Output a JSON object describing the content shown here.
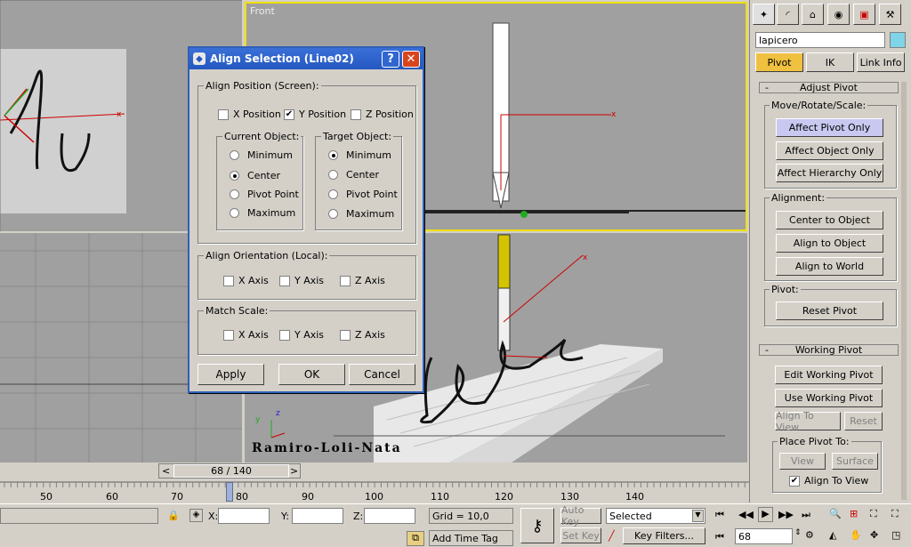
{
  "viewports": {
    "front_label": "Front",
    "watermark": "Ramiro-Loli-Nata"
  },
  "dialog": {
    "title": "Align Selection (Line02)",
    "help_btn": "?",
    "close_btn": "✕",
    "align_position_group": "Align Position (Screen):",
    "x_position": "X Position",
    "y_position": "Y Position",
    "z_position": "Z Position",
    "current_object_group": "Current Object:",
    "target_object_group": "Target Object:",
    "opt_minimum": "Minimum",
    "opt_center": "Center",
    "opt_pivot": "Pivot Point",
    "opt_maximum": "Maximum",
    "align_orientation_group": "Align Orientation (Local):",
    "match_scale_group": "Match Scale:",
    "x_axis": "X Axis",
    "y_axis": "Y Axis",
    "z_axis": "Z Axis",
    "apply": "Apply",
    "ok": "OK",
    "cancel": "Cancel"
  },
  "panel": {
    "object_name": "lapicero",
    "tabs": {
      "pivot": "Pivot",
      "ik": "IK",
      "link_info": "Link Info"
    },
    "adjust_pivot": "Adjust Pivot",
    "minus": "-",
    "move_rotate_scale": "Move/Rotate/Scale:",
    "affect_pivot_only": "Affect Pivot Only",
    "affect_object_only": "Affect Object Only",
    "affect_hierarchy_only": "Affect Hierarchy Only",
    "alignment": "Alignment:",
    "center_to_object": "Center to Object",
    "align_to_object": "Align to Object",
    "align_to_world": "Align to World",
    "pivot": "Pivot:",
    "reset_pivot": "Reset Pivot",
    "working_pivot": "Working Pivot",
    "edit_working_pivot": "Edit Working Pivot",
    "use_working_pivot": "Use Working Pivot",
    "align_to_view": "Align To View",
    "reset": "Reset",
    "place_pivot_to": "Place Pivot To:",
    "view": "View",
    "surface": "Surface",
    "align_to_view_check": "Align To View"
  },
  "timeline": {
    "slider_label": "68 / 140",
    "ticks": [
      "50",
      "60",
      "70",
      "80",
      "90",
      "100",
      "110",
      "120",
      "130",
      "140"
    ],
    "prev_arrow": "<",
    "next_arrow": ">"
  },
  "status": {
    "x_label": "X:",
    "y_label": "Y:",
    "z_label": "Z:",
    "grid": "Grid = 10,0",
    "auto_key": "Auto Key",
    "set_key": "Set Key",
    "selected": "Selected",
    "key_filters": "Key Filters...",
    "add_time_tag": "Add Time Tag",
    "frame": "68"
  }
}
